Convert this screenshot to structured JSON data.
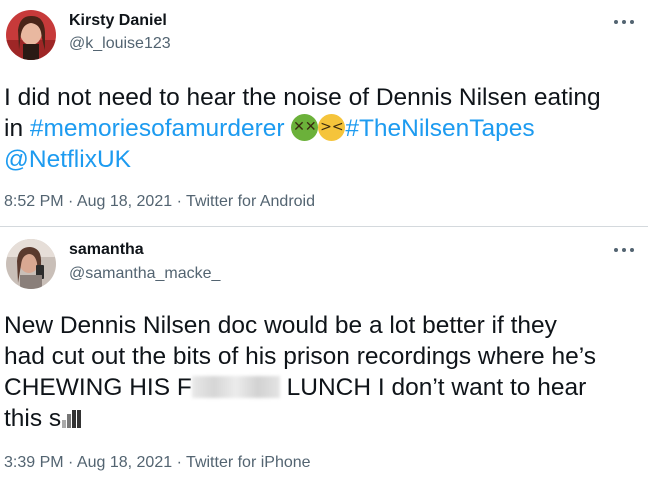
{
  "tweets": [
    {
      "name": "Kirsty Daniel",
      "handle": "@k_louise123",
      "text_plain_1": "I did not need to hear the noise of Dennis Nilsen eating",
      "text_plain_2": "in ",
      "hashtag_1": "#memoriesofamurderer",
      "emoji_1": "nauseated-face",
      "emoji_2": "face-vomiting",
      "hashtag_2": "#TheNilsenTapes",
      "mention": "@NetflixUK",
      "timestamp": "8:52 PM · Aug 18, 2021 · Twitter for Android"
    },
    {
      "name": "samantha",
      "handle": "@samantha_macke_",
      "line_1": "New Dennis Nilsen doc would be a lot better if they",
      "line_2": "had cut out the bits of his prison recordings where he’s",
      "line_3a": "CHEWING HIS F",
      "line_3b": " LUNCH I don’t want to hear",
      "line_4a": "this s",
      "timestamp": "3:39 PM · Aug 18, 2021 · Twitter for iPhone"
    }
  ],
  "colors": {
    "link": "#1d9bf0",
    "secondary_text": "#536471",
    "primary_text": "#0f1419"
  }
}
